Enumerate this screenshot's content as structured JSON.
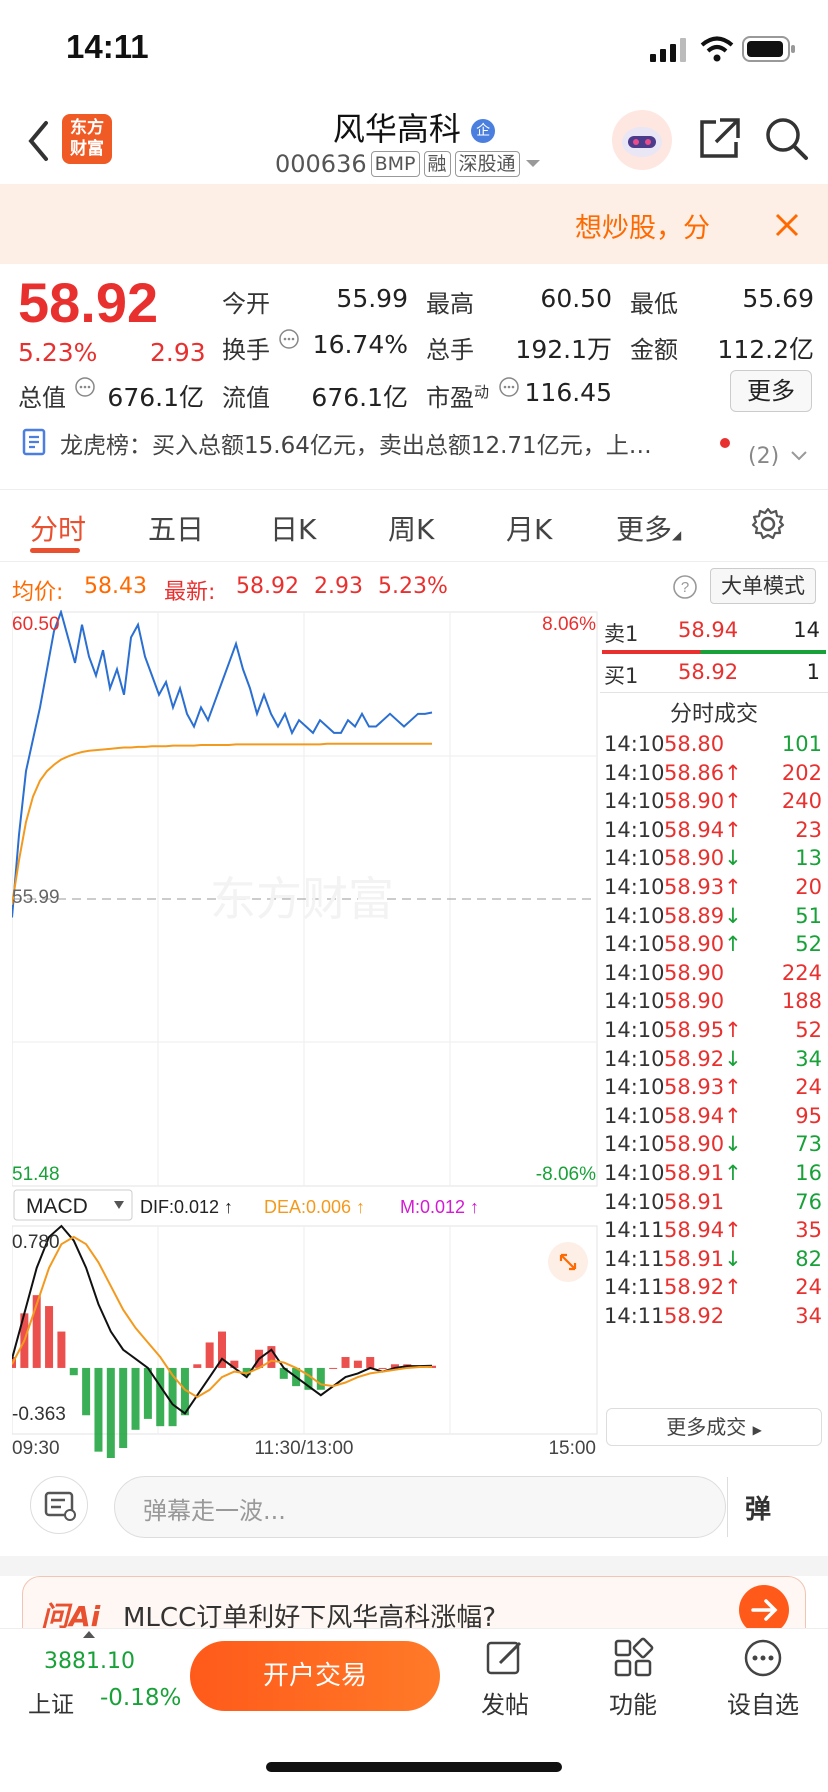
{
  "status_bar": {
    "time": "14:11"
  },
  "header": {
    "logo_text": "东方财富",
    "stock_name": "风华高科",
    "stock_badge": "企",
    "stock_code": "000636",
    "tags": [
      "BMP",
      "融",
      "深股通"
    ]
  },
  "banner": {
    "text": "想炒股，分"
  },
  "quote": {
    "last_price": "58.92",
    "change_pct": "5.23%",
    "change": "2.93",
    "fields": [
      {
        "label": "今开",
        "value": "55.99"
      },
      {
        "label": "最高",
        "value": "60.50"
      },
      {
        "label": "最低",
        "value": "55.69"
      },
      {
        "label": "换手",
        "value": "16.74%"
      },
      {
        "label": "总手",
        "value": "192.1万"
      },
      {
        "label": "金额",
        "value": "112.2亿"
      },
      {
        "label": "总值",
        "value": "676.1亿"
      },
      {
        "label": "流值",
        "value": "676.1亿"
      },
      {
        "label": "市盈",
        "sup": "动",
        "value": "116.45"
      }
    ],
    "more_label": "更多"
  },
  "news": {
    "text": "龙虎榜：买入总额15.64亿元，卖出总额12.71亿元，上…",
    "count": "(2)"
  },
  "tabs": [
    "分时",
    "五日",
    "日K",
    "周K",
    "月K",
    "更多"
  ],
  "info_row": {
    "avg_label": "均价:",
    "avg_value": "58.43",
    "latest_label": "最新:",
    "latest_price": "58.92",
    "latest_change": "2.93",
    "latest_pct": "5.23%",
    "big_order_label": "大单模式"
  },
  "chart_data": [
    {
      "type": "line",
      "name": "intraday",
      "ylim": [
        51.48,
        60.5
      ],
      "y_ticks_left": [
        "60.50",
        "55.99",
        "51.48"
      ],
      "y_ticks_right": [
        "8.06%",
        "-8.06%"
      ],
      "watermark": "东方财富",
      "x_ticks": [
        "09:30",
        "11:30/13:00",
        "15:00"
      ],
      "price": [
        55.7,
        57.0,
        58.0,
        58.5,
        59.0,
        59.6,
        60.2,
        60.5,
        60.1,
        59.7,
        60.3,
        59.8,
        59.5,
        59.9,
        59.3,
        59.6,
        59.2,
        60.1,
        60.3,
        59.8,
        59.5,
        59.2,
        59.4,
        59.0,
        59.3,
        58.9,
        58.7,
        59.0,
        58.8,
        59.1,
        59.4,
        59.7,
        60.0,
        59.6,
        59.3,
        58.9,
        59.2,
        58.9,
        58.7,
        58.9,
        58.6,
        58.8,
        58.7,
        58.6,
        58.8,
        58.7,
        58.6,
        58.6,
        58.8,
        58.7,
        58.9,
        58.7,
        58.7,
        58.8,
        58.9,
        58.8,
        58.7,
        58.8,
        58.9,
        58.9,
        58.92
      ],
      "avg": [
        55.9,
        56.6,
        57.2,
        57.6,
        57.85,
        58.0,
        58.1,
        58.18,
        58.23,
        58.27,
        58.3,
        58.32,
        58.33,
        58.34,
        58.35,
        58.36,
        58.37,
        58.37,
        58.38,
        58.38,
        58.39,
        58.39,
        58.39,
        58.4,
        58.4,
        58.4,
        58.4,
        58.41,
        58.41,
        58.41,
        58.41,
        58.41,
        58.42,
        58.42,
        58.42,
        58.42,
        58.42,
        58.42,
        58.42,
        58.42,
        58.42,
        58.42,
        58.42,
        58.42,
        58.42,
        58.43,
        58.43,
        58.43,
        58.43,
        58.43,
        58.43,
        58.43,
        58.43,
        58.43,
        58.43,
        58.43,
        58.43,
        58.43,
        58.43,
        58.43,
        58.43
      ]
    },
    {
      "type": "bar",
      "name": "MACD",
      "selector_label": "MACD",
      "dif_label": "DIF:0.012 ↑",
      "dea_label": "DEA:0.006 ↑",
      "m_label": "M:0.012 ↑",
      "ylim": [
        -0.363,
        0.78
      ],
      "y_ticks": [
        "0.780",
        "-0.363"
      ],
      "dif": [
        0.05,
        0.3,
        0.55,
        0.72,
        0.78,
        0.7,
        0.55,
        0.35,
        0.2,
        0.1,
        0.05,
        0.0,
        -0.1,
        -0.2,
        -0.25,
        -0.15,
        -0.05,
        0.05,
        0.0,
        -0.05,
        0.05,
        0.1,
        0.0,
        -0.05,
        -0.1,
        -0.15,
        -0.1,
        -0.05,
        -0.03,
        0.0,
        -0.02,
        0.0,
        0.01,
        0.01,
        0.012
      ],
      "dea": [
        0.02,
        0.15,
        0.35,
        0.55,
        0.68,
        0.72,
        0.68,
        0.58,
        0.45,
        0.32,
        0.22,
        0.14,
        0.06,
        -0.04,
        -0.12,
        -0.16,
        -0.12,
        -0.05,
        -0.02,
        -0.03,
        0.0,
        0.04,
        0.03,
        0.0,
        -0.04,
        -0.09,
        -0.1,
        -0.08,
        -0.05,
        -0.03,
        -0.02,
        -0.01,
        0.0,
        0.005,
        0.006
      ],
      "macd": [
        0.06,
        0.3,
        0.4,
        0.34,
        0.2,
        -0.04,
        -0.26,
        -0.46,
        -0.5,
        -0.44,
        -0.34,
        -0.28,
        -0.32,
        -0.32,
        -0.26,
        0.02,
        0.14,
        0.2,
        0.04,
        -0.04,
        0.1,
        0.12,
        -0.06,
        -0.1,
        -0.12,
        -0.12,
        0.0,
        0.06,
        0.04,
        0.06,
        0.0,
        0.02,
        0.02,
        0.01,
        0.012
      ]
    }
  ],
  "ticks_panel": {
    "ask_label": "卖1",
    "ask_price": "58.94",
    "ask_vol": "14",
    "bid_label": "买1",
    "bid_price": "58.92",
    "bid_vol": "1",
    "title": "分时成交",
    "rows": [
      {
        "time": "14:10",
        "price": "58.80",
        "arrow": "",
        "vol": "101",
        "color": "green"
      },
      {
        "time": "14:10",
        "price": "58.86",
        "arrow": "↑",
        "vol": "202",
        "color": "red"
      },
      {
        "time": "14:10",
        "price": "58.90",
        "arrow": "↑",
        "vol": "240",
        "color": "red"
      },
      {
        "time": "14:10",
        "price": "58.94",
        "arrow": "↑",
        "vol": "23",
        "color": "red"
      },
      {
        "time": "14:10",
        "price": "58.90",
        "arrow": "↓",
        "vol": "13",
        "color": "green"
      },
      {
        "time": "14:10",
        "price": "58.93",
        "arrow": "↑",
        "vol": "20",
        "color": "red"
      },
      {
        "time": "14:10",
        "price": "58.89",
        "arrow": "↓",
        "vol": "51",
        "color": "green"
      },
      {
        "time": "14:10",
        "price": "58.90",
        "arrow": "↑",
        "vol": "52",
        "color": "green"
      },
      {
        "time": "14:10",
        "price": "58.90",
        "arrow": "",
        "vol": "224",
        "color": "red"
      },
      {
        "time": "14:10",
        "price": "58.90",
        "arrow": "",
        "vol": "188",
        "color": "red"
      },
      {
        "time": "14:10",
        "price": "58.95",
        "arrow": "↑",
        "vol": "52",
        "color": "red"
      },
      {
        "time": "14:10",
        "price": "58.92",
        "arrow": "↓",
        "vol": "34",
        "color": "green"
      },
      {
        "time": "14:10",
        "price": "58.93",
        "arrow": "↑",
        "vol": "24",
        "color": "red"
      },
      {
        "time": "14:10",
        "price": "58.94",
        "arrow": "↑",
        "vol": "95",
        "color": "red"
      },
      {
        "time": "14:10",
        "price": "58.90",
        "arrow": "↓",
        "vol": "73",
        "color": "green"
      },
      {
        "time": "14:10",
        "price": "58.91",
        "arrow": "↑",
        "vol": "16",
        "color": "green"
      },
      {
        "time": "14:10",
        "price": "58.91",
        "arrow": "",
        "vol": "76",
        "color": "green"
      },
      {
        "time": "14:11",
        "price": "58.94",
        "arrow": "↑",
        "vol": "35",
        "color": "red"
      },
      {
        "time": "14:11",
        "price": "58.91",
        "arrow": "↓",
        "vol": "82",
        "color": "green"
      },
      {
        "time": "14:11",
        "price": "58.92",
        "arrow": "↑",
        "vol": "24",
        "color": "red"
      },
      {
        "time": "14:11",
        "price": "58.92",
        "arrow": "",
        "vol": "34",
        "color": "red"
      }
    ],
    "more_label": "更多成交"
  },
  "comment_bar": {
    "placeholder": "弹幕走一波...",
    "danmaku_label": "弹"
  },
  "ai_bar": {
    "logo": "问Ai",
    "question": "MLCC订单利好下风华高科涨幅?"
  },
  "bottom_nav": {
    "index_value": "3881.10",
    "index_name": "上证",
    "index_pct": "-0.18%",
    "open_label": "开户交易",
    "items": [
      "发帖",
      "功能",
      "设自选"
    ]
  },
  "colors": {
    "up": "#e8312f",
    "down": "#18a138",
    "accent": "#ff6a00",
    "price_line": "#2a6fd1",
    "avg_line": "#f39a1e"
  }
}
